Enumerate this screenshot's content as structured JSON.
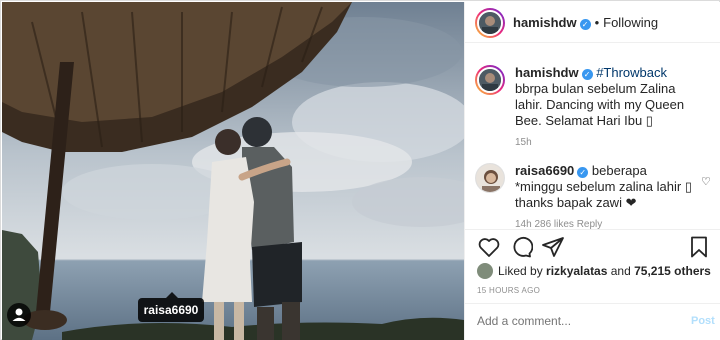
{
  "post": {
    "author": "hamishdw",
    "header_separator": "•",
    "follow_status": "Following",
    "photo_tag": "raisa6690"
  },
  "caption": {
    "username": "hamishdw",
    "hashtag": "#Throwback",
    "text": " bbrpa bulan sebelum Zalina lahir. Dancing with my Queen Bee. Selamat Hari Ibu ",
    "emoji": "▯",
    "time": "15h"
  },
  "comments": [
    {
      "username": "raisa6690",
      "text": " beberapa *minggu sebelum zalina lahir ▯ thanks bapak zawi ❤",
      "meta": "14h   286 likes   Reply"
    }
  ],
  "likes": {
    "prefix": "Liked by ",
    "first_user": "rizkyalatas",
    "middle": " and ",
    "others": "75,215 others"
  },
  "timestamp": "15 HOURS AGO",
  "add_comment": {
    "placeholder": "Add a comment...",
    "post_label": "Post"
  },
  "icons": {
    "verified": "verified-badge-icon",
    "like": "heart-icon",
    "comment": "comment-bubble-icon",
    "share": "paper-plane-icon",
    "save": "bookmark-icon",
    "tagged_user": "user-tag-icon"
  },
  "colors": {
    "verified": "#3897f0",
    "hashtag": "#00376b",
    "post_button_disabled": "#b2dffc",
    "muted_text": "#8e8e8e"
  }
}
